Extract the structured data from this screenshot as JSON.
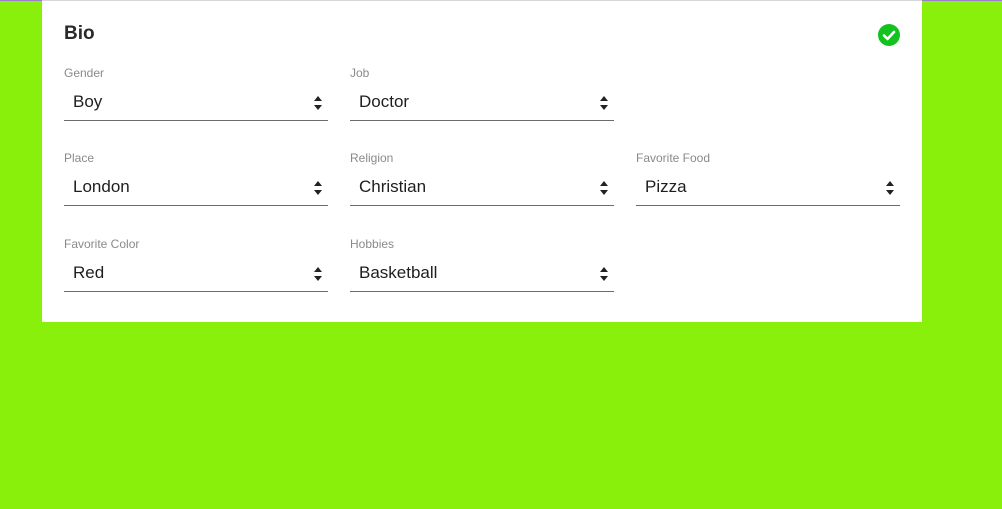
{
  "card": {
    "title": "Bio",
    "status_icon": "check-circle-icon"
  },
  "fields": [
    {
      "label": "Gender",
      "value": "Boy"
    },
    {
      "label": "Job",
      "value": "Doctor"
    },
    {
      "label": "Place",
      "value": "London"
    },
    {
      "label": "Religion",
      "value": "Christian"
    },
    {
      "label": "Favorite Food",
      "value": "Pizza"
    },
    {
      "label": "Favorite Color",
      "value": "Red"
    },
    {
      "label": "Hobbies",
      "value": "Basketball"
    }
  ],
  "colors": {
    "background": "#88f00a",
    "card": "#ffffff",
    "success": "#13c21f"
  }
}
